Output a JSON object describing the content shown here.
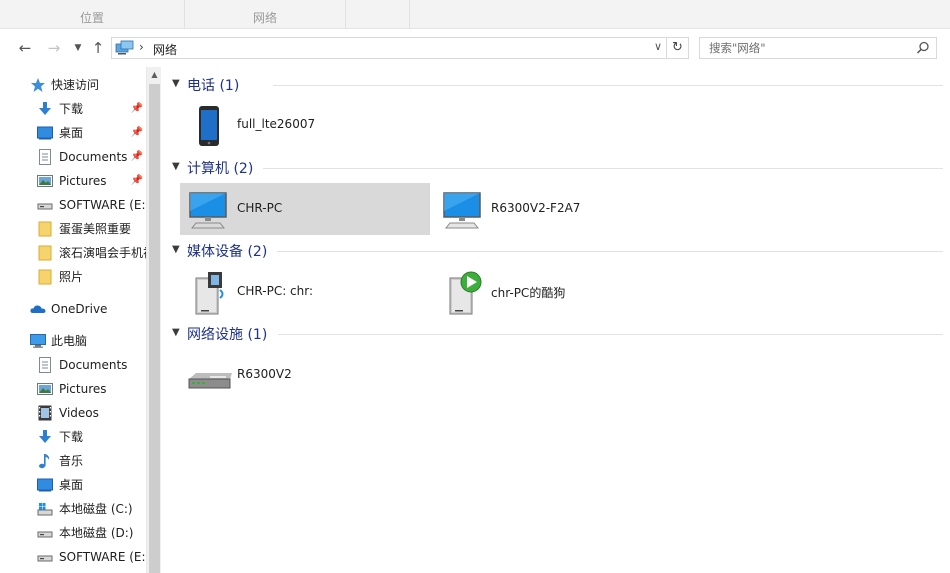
{
  "ribbon": {
    "groups": [
      "位置",
      "网络"
    ]
  },
  "address": {
    "crumb": "网络"
  },
  "search": {
    "placeholder": "搜索\"网络\""
  },
  "sidebar": {
    "items": [
      {
        "label": "快速访问",
        "icon": "star-icon",
        "type": "root"
      },
      {
        "label": "下载",
        "icon": "download-arrow-icon",
        "type": "child",
        "pinned": true
      },
      {
        "label": "桌面",
        "icon": "desktop-icon",
        "type": "child",
        "pinned": true
      },
      {
        "label": "Documents",
        "icon": "document-icon",
        "type": "child",
        "pinned": true
      },
      {
        "label": "Pictures",
        "icon": "pictures-icon",
        "type": "child",
        "pinned": true
      },
      {
        "label": "SOFTWARE (E:)",
        "icon": "drive-icon",
        "type": "child"
      },
      {
        "label": "蛋蛋美照重要",
        "icon": "folder-icon",
        "type": "child"
      },
      {
        "label": "滚石演唱会手机视频",
        "icon": "folder-icon",
        "type": "child"
      },
      {
        "label": "照片",
        "icon": "folder-icon",
        "type": "child"
      },
      {
        "label": "OneDrive",
        "icon": "cloud-icon",
        "type": "root"
      },
      {
        "label": "此电脑",
        "icon": "computer-icon",
        "type": "root"
      },
      {
        "label": "Documents",
        "icon": "document-icon",
        "type": "child"
      },
      {
        "label": "Pictures",
        "icon": "pictures-icon",
        "type": "child"
      },
      {
        "label": "Videos",
        "icon": "film-icon",
        "type": "child"
      },
      {
        "label": "下载",
        "icon": "download-arrow-icon",
        "type": "child"
      },
      {
        "label": "音乐",
        "icon": "music-note-icon",
        "type": "child"
      },
      {
        "label": "桌面",
        "icon": "desktop-icon",
        "type": "child"
      },
      {
        "label": "本地磁盘 (C:)",
        "icon": "windows-drive-icon",
        "type": "child"
      },
      {
        "label": "本地磁盘 (D:)",
        "icon": "drive-icon",
        "type": "child"
      },
      {
        "label": "SOFTWARE (E:)",
        "icon": "drive-icon",
        "type": "child"
      }
    ]
  },
  "groups": [
    {
      "title": "电话 (1)",
      "items": [
        {
          "label": "full_lte26007",
          "icon": "phone-icon"
        }
      ]
    },
    {
      "title": "计算机 (2)",
      "items": [
        {
          "label": "CHR-PC",
          "icon": "computer-icon",
          "selected": true
        },
        {
          "label": "R6300V2-F2A7",
          "icon": "computer-icon"
        }
      ]
    },
    {
      "title": "媒体设备 (2)",
      "items": [
        {
          "label": "CHR-PC: chr:",
          "icon": "media-server-icon"
        },
        {
          "label": "chr-PC的酷狗",
          "icon": "media-player-icon"
        }
      ]
    },
    {
      "title": "网络设施 (1)",
      "items": [
        {
          "label": "R6300V2",
          "icon": "router-icon"
        }
      ]
    }
  ],
  "colors": {
    "accent": "#1e3287",
    "selection": "#d9d9d9",
    "ribbon": "#f3f3f3"
  }
}
